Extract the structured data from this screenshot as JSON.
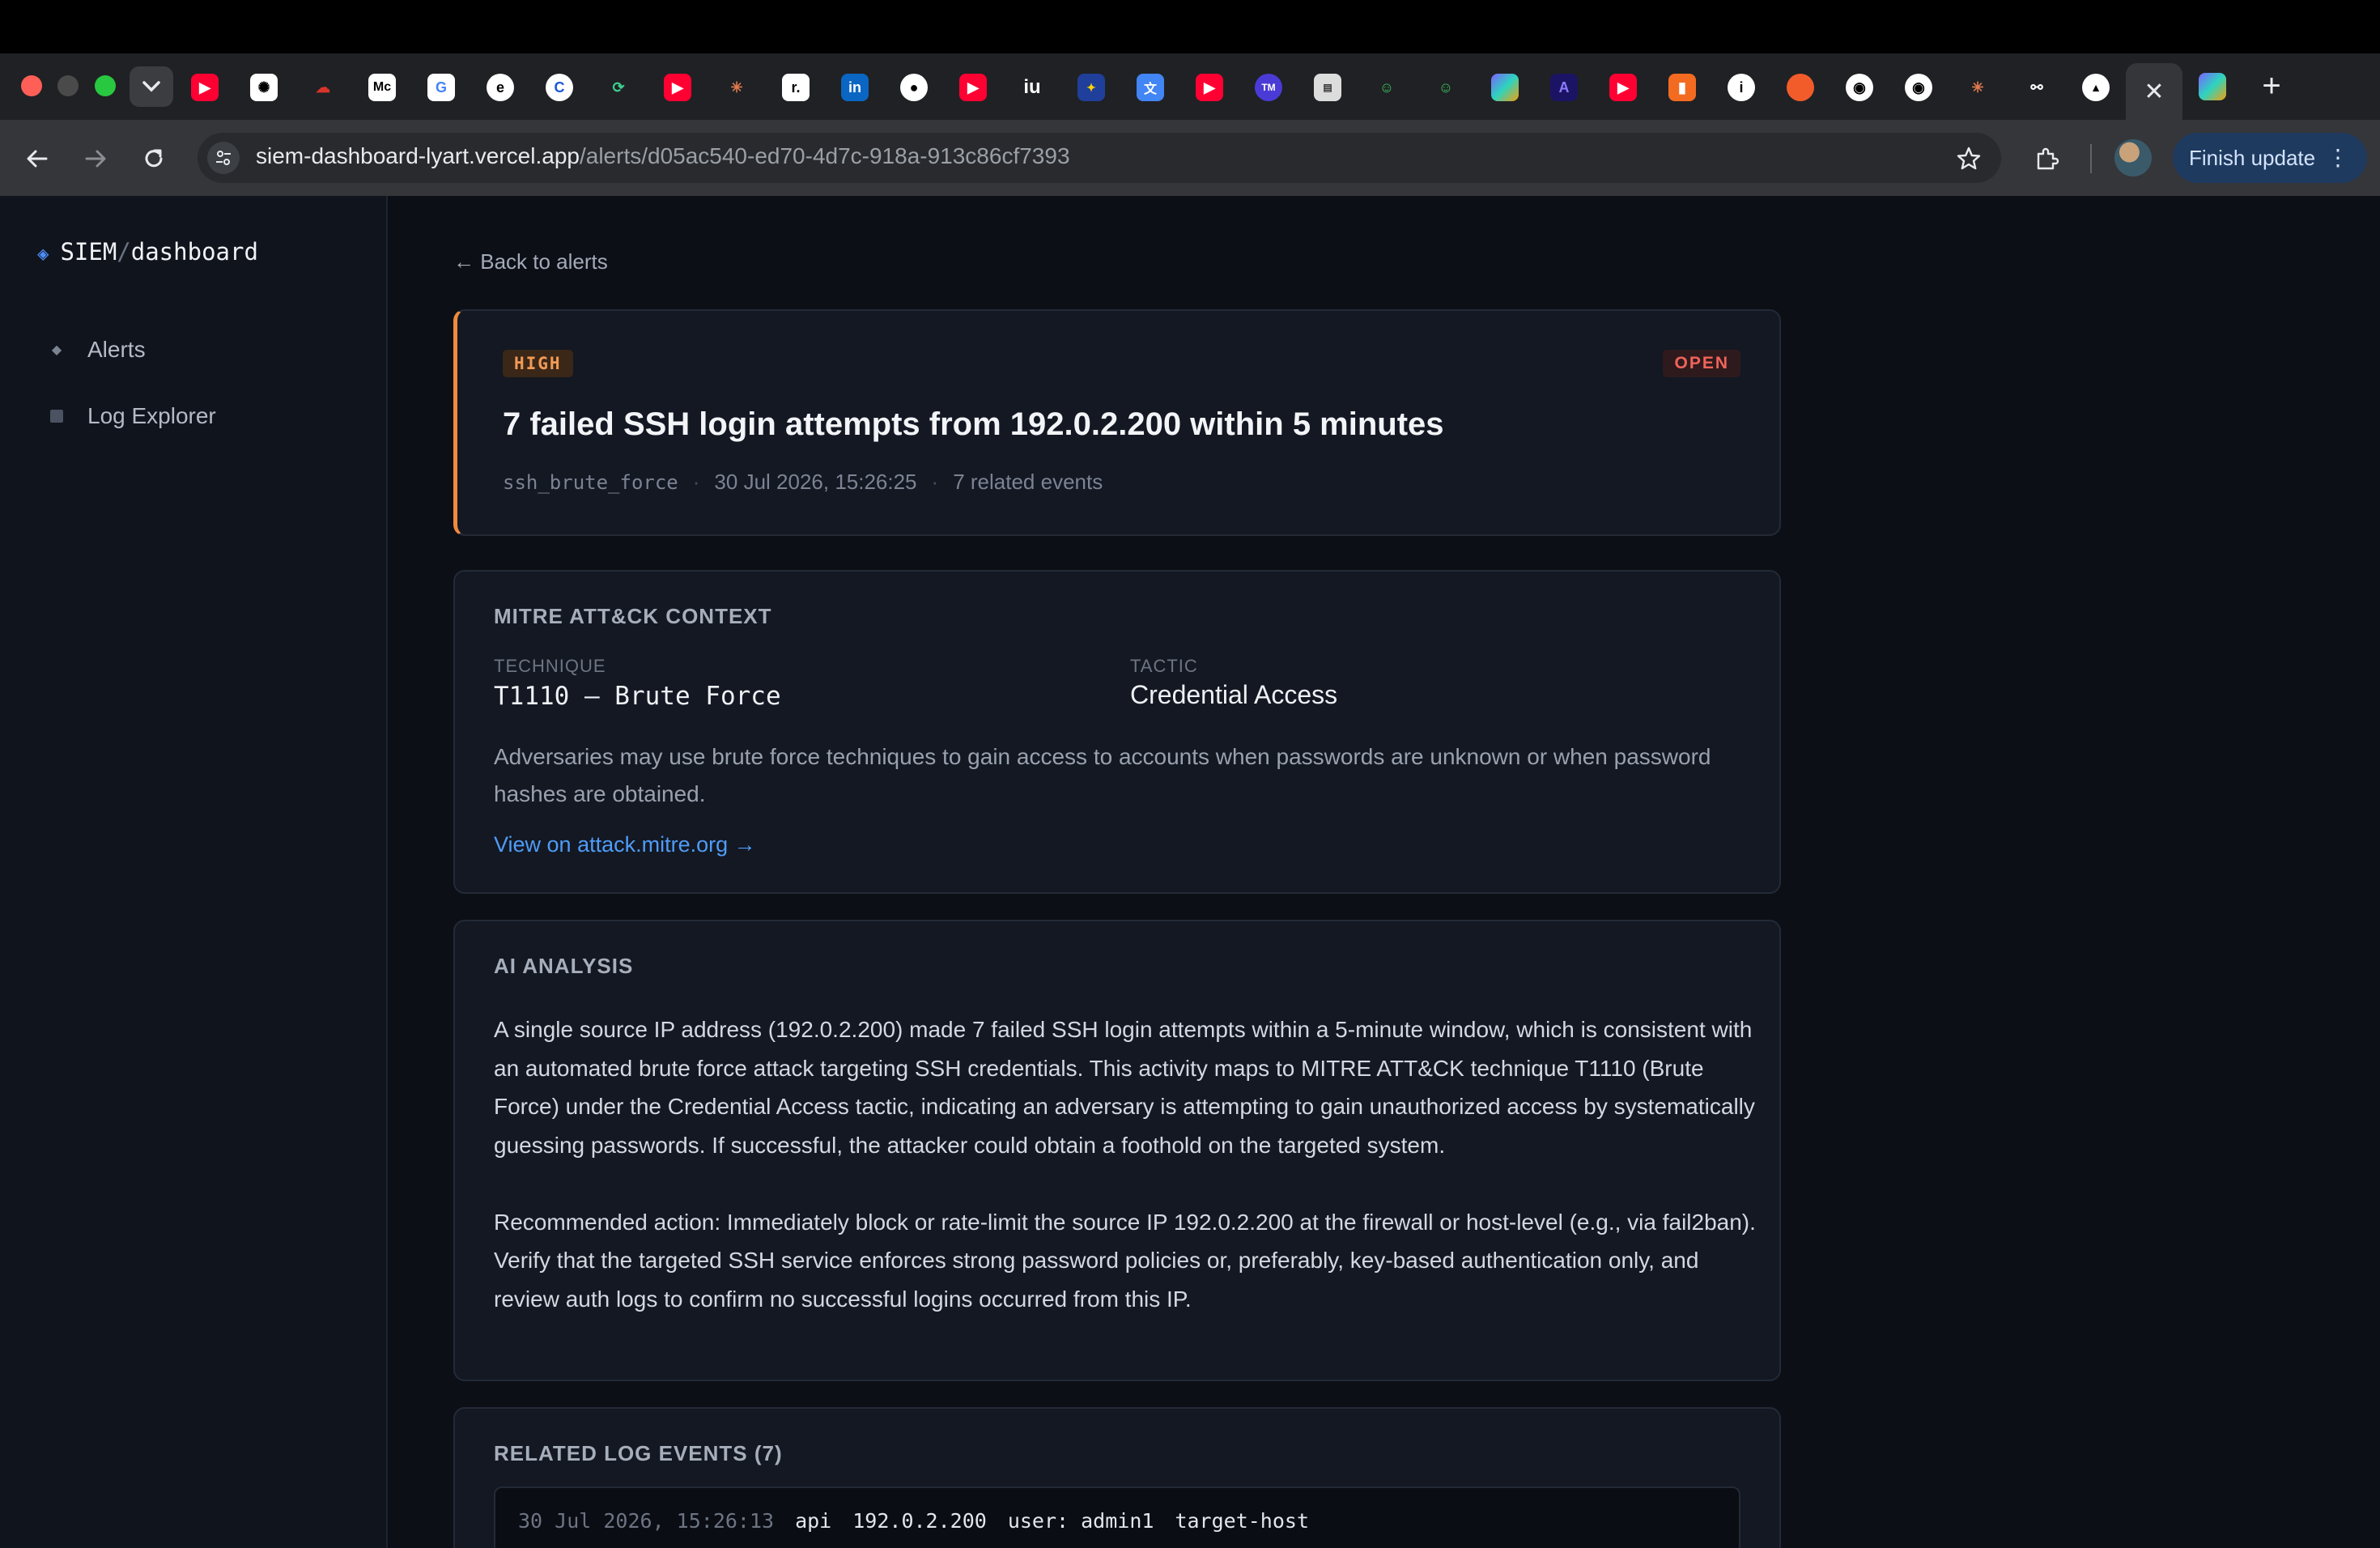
{
  "browser": {
    "url_host": "siem-dashboard-lyart.vercel.app",
    "url_path": "/alerts/d05ac540-ed70-4d7c-918a-913c86cf7393",
    "finish_update_label": "Finish update",
    "favicon_icons": [
      "youtube-icon",
      "chatgpt-icon",
      "cloud-icon",
      "medium-icon",
      "google-icon",
      "e-icon",
      "c-icon",
      "refresh-app-icon",
      "youtube-icon",
      "claude-icon",
      "r-icon",
      "linkedin-icon",
      "apple-icon",
      "youtube-icon",
      "iu-icon",
      "eu-icon",
      "translate-icon",
      "youtube-icon",
      "tm-icon",
      "news-icon",
      "smiley-icon",
      "smiley-icon",
      "copilot-icon",
      "a-icon",
      "youtube-icon",
      "bookmark-icon",
      "info-icon",
      "orange-icon",
      "github-icon",
      "github-icon",
      "claude-icon",
      "link-icon",
      "vercel-icon"
    ]
  },
  "sidebar": {
    "brand_main": "SIEM",
    "brand_sep": "/",
    "brand_sub": "dashboard",
    "items": [
      {
        "label": "Alerts",
        "icon": "diamond-icon"
      },
      {
        "label": "Log Explorer",
        "icon": "square-icon"
      }
    ]
  },
  "main": {
    "back_label": "← Back to alerts",
    "alert": {
      "severity": "HIGH",
      "status": "OPEN",
      "title": "7 failed SSH login attempts from 192.0.2.200 within 5 minutes",
      "rule": "ssh_brute_force",
      "timestamp": "30 Jul 2026, 15:26:25",
      "related_count": "7 related events",
      "severity_color": "#f08a3c",
      "status_color": "#f0645a"
    },
    "mitre": {
      "section_title": "MITRE ATT&CK CONTEXT",
      "technique_label": "TECHNIQUE",
      "technique_value": "T1110 — Brute Force",
      "tactic_label": "TACTIC",
      "tactic_value": "Credential Access",
      "description": "Adversaries may use brute force techniques to gain access to accounts when passwords are unknown or when password hashes are obtained.",
      "link_label": "View on attack.mitre.org →"
    },
    "ai": {
      "section_title": "AI ANALYSIS",
      "paragraph_1": "A single source IP address (192.0.2.200) made 7 failed SSH login attempts within a 5-minute window, which is consistent with an automated brute force attack targeting SSH credentials. This activity maps to MITRE ATT&CK technique T1110 (Brute Force) under the Credential Access tactic, indicating an adversary is attempting to gain unauthorized access by systematically guessing passwords. If successful, the attacker could obtain a foothold on the targeted system.",
      "paragraph_2": "Recommended action: Immediately block or rate-limit the source IP 192.0.2.200 at the firewall or host-level (e.g., via fail2ban). Verify that the targeted SSH service enforces strong password policies or, preferably, key-based authentication only, and review auth logs to confirm no successful logins occurred from this IP."
    },
    "related": {
      "section_title": "RELATED LOG EVENTS (7)",
      "events": [
        {
          "timestamp": "30 Jul 2026, 15:26:13",
          "source": "api",
          "ip": "192.0.2.200",
          "user": "user: admin1",
          "host": "target-host"
        }
      ]
    }
  }
}
